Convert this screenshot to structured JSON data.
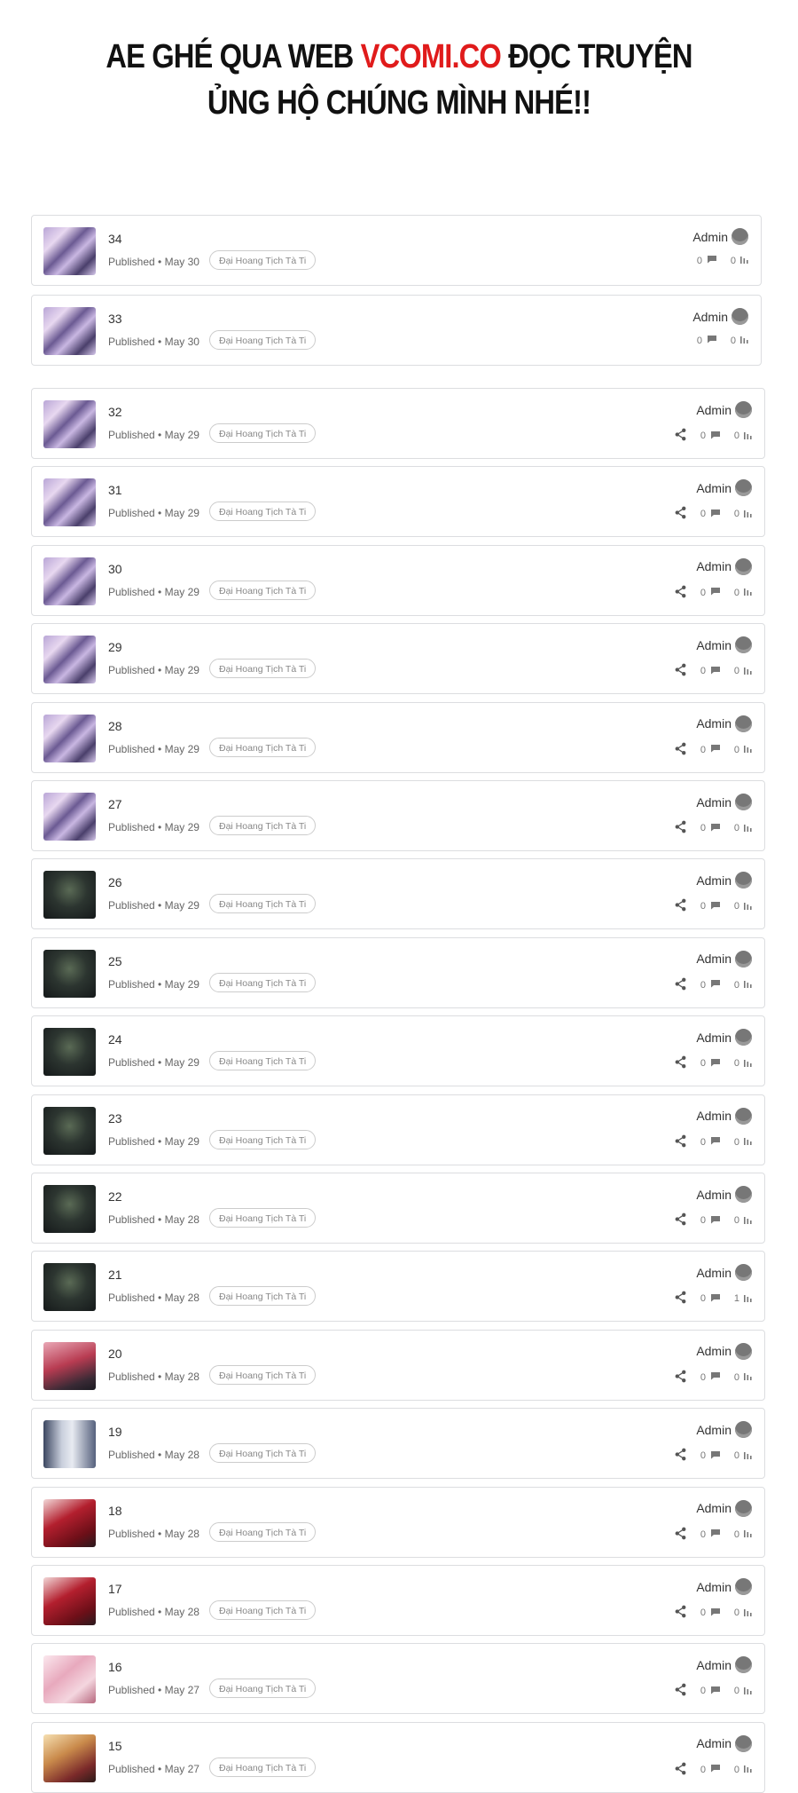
{
  "banner": {
    "line1_prefix": "AE GHÉ QUA WEB ",
    "line1_brand": "VCOMI.CO",
    "line1_suffix": " ĐỌC TRUYỆN",
    "line2": "ỦNG HỘ CHÚNG MÌNH NHÉ!!",
    "brand_color": "#e01b1b"
  },
  "group_a": [
    {
      "chapter": "34",
      "published": "Published • May 30",
      "series": "Đại Hoang Tịch Tà Ti",
      "author": "Admin",
      "comments": "0",
      "views": "0",
      "thumb": "purple-art"
    },
    {
      "chapter": "33",
      "published": "Published • May 30",
      "series": "Đại Hoang Tịch Tà Ti",
      "author": "Admin",
      "comments": "0",
      "views": "0",
      "thumb": "purple-art"
    }
  ],
  "group_b": [
    {
      "chapter": "32",
      "published": "Published • May 29",
      "series": "Đại Hoang Tịch Tà Ti",
      "author": "Admin",
      "comments": "0",
      "views": "0",
      "thumb": "purple-art"
    },
    {
      "chapter": "31",
      "published": "Published • May 29",
      "series": "Đại Hoang Tịch Tà Ti",
      "author": "Admin",
      "comments": "0",
      "views": "0",
      "thumb": "purple-art"
    },
    {
      "chapter": "30",
      "published": "Published • May 29",
      "series": "Đại Hoang Tịch Tà Ti",
      "author": "Admin",
      "comments": "0",
      "views": "0",
      "thumb": "purple-art"
    },
    {
      "chapter": "29",
      "published": "Published • May 29",
      "series": "Đại Hoang Tịch Tà Ti",
      "author": "Admin",
      "comments": "0",
      "views": "0",
      "thumb": "purple-art"
    },
    {
      "chapter": "28",
      "published": "Published • May 29",
      "series": "Đại Hoang Tịch Tà Ti",
      "author": "Admin",
      "comments": "0",
      "views": "0",
      "thumb": "purple-art"
    },
    {
      "chapter": "27",
      "published": "Published • May 29",
      "series": "Đại Hoang Tịch Tà Ti",
      "author": "Admin",
      "comments": "0",
      "views": "0",
      "thumb": "purple-art"
    },
    {
      "chapter": "26",
      "published": "Published • May 29",
      "series": "Đại Hoang Tịch Tà Ti",
      "author": "Admin",
      "comments": "0",
      "views": "0",
      "thumb": "dark-armor"
    },
    {
      "chapter": "25",
      "published": "Published • May 29",
      "series": "Đại Hoang Tịch Tà Ti",
      "author": "Admin",
      "comments": "0",
      "views": "0",
      "thumb": "dark-armor"
    },
    {
      "chapter": "24",
      "published": "Published • May 29",
      "series": "Đại Hoang Tịch Tà Ti",
      "author": "Admin",
      "comments": "0",
      "views": "0",
      "thumb": "dark-armor"
    },
    {
      "chapter": "23",
      "published": "Published • May 29",
      "series": "Đại Hoang Tịch Tà Ti",
      "author": "Admin",
      "comments": "0",
      "views": "0",
      "thumb": "dark-armor"
    },
    {
      "chapter": "22",
      "published": "Published • May 28",
      "series": "Đại Hoang Tịch Tà Ti",
      "author": "Admin",
      "comments": "0",
      "views": "0",
      "thumb": "dark-armor"
    },
    {
      "chapter": "21",
      "published": "Published • May 28",
      "series": "Đại Hoang Tịch Tà Ti",
      "author": "Admin",
      "comments": "0",
      "views": "1",
      "thumb": "dark-armor"
    },
    {
      "chapter": "20",
      "published": "Published • May 28",
      "series": "Đại Hoang Tịch Tà Ti",
      "author": "Admin",
      "comments": "0",
      "views": "0",
      "thumb": "red-pink"
    },
    {
      "chapter": "19",
      "published": "Published • May 28",
      "series": "Đại Hoang Tịch Tà Ti",
      "author": "Admin",
      "comments": "0",
      "views": "0",
      "thumb": "blue-legs"
    },
    {
      "chapter": "18",
      "published": "Published • May 28",
      "series": "Đại Hoang Tịch Tà Ti",
      "author": "Admin",
      "comments": "0",
      "views": "0",
      "thumb": "red-dress"
    },
    {
      "chapter": "17",
      "published": "Published • May 28",
      "series": "Đại Hoang Tịch Tà Ti",
      "author": "Admin",
      "comments": "0",
      "views": "0",
      "thumb": "red-dress"
    },
    {
      "chapter": "16",
      "published": "Published • May 27",
      "series": "Đại Hoang Tịch Tà Ti",
      "author": "Admin",
      "comments": "0",
      "views": "0",
      "thumb": "pink-girl"
    },
    {
      "chapter": "15",
      "published": "Published • May 27",
      "series": "Đại Hoang Tịch Tà Ti",
      "author": "Admin",
      "comments": "0",
      "views": "0",
      "thumb": "gold-hair"
    }
  ],
  "icons": {
    "share": "share-icon",
    "comment": "comment-icon",
    "views": "bar-chart-icon",
    "avatar": "avatar"
  }
}
